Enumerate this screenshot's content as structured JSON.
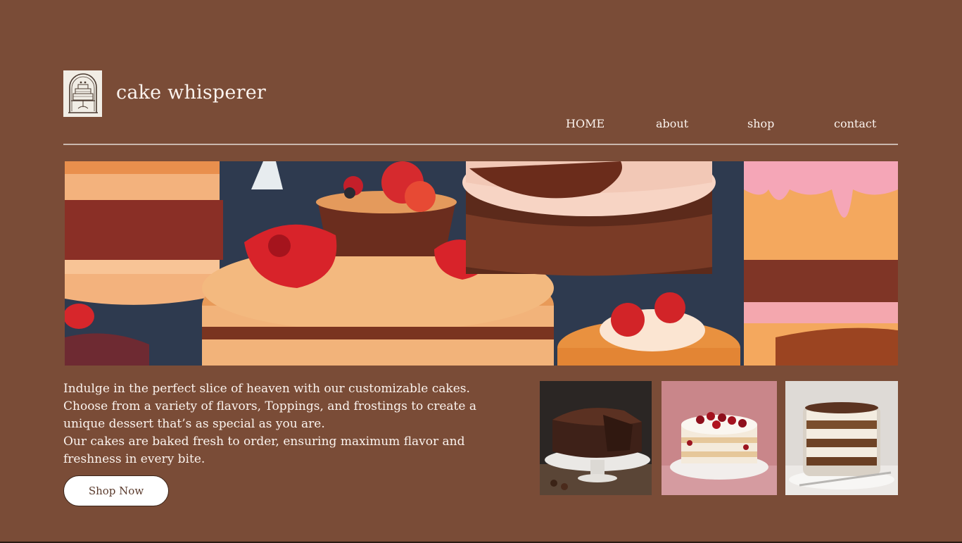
{
  "brand": {
    "name": "cake whisperer",
    "logo_icon": "cake-arch-logo-icon"
  },
  "nav": {
    "items": [
      {
        "label": "HOME"
      },
      {
        "label": "about"
      },
      {
        "label": "shop"
      },
      {
        "label": "contact"
      }
    ]
  },
  "intro": {
    "lines": [
      "Indulge in the perfect slice of heaven with our customizable cakes.",
      "Choose from a variety of flavors, Toppings, and frostings to create a unique dessert that’s as special as you are.",
      "Our cakes are baked fresh to order, ensuring maximum flavor and freshness in every bite."
    ]
  },
  "cta": {
    "label": "Shop Now"
  },
  "colors": {
    "background": "#7a4c37",
    "text": "#fbf3ee",
    "button_bg": "#ffffff"
  }
}
